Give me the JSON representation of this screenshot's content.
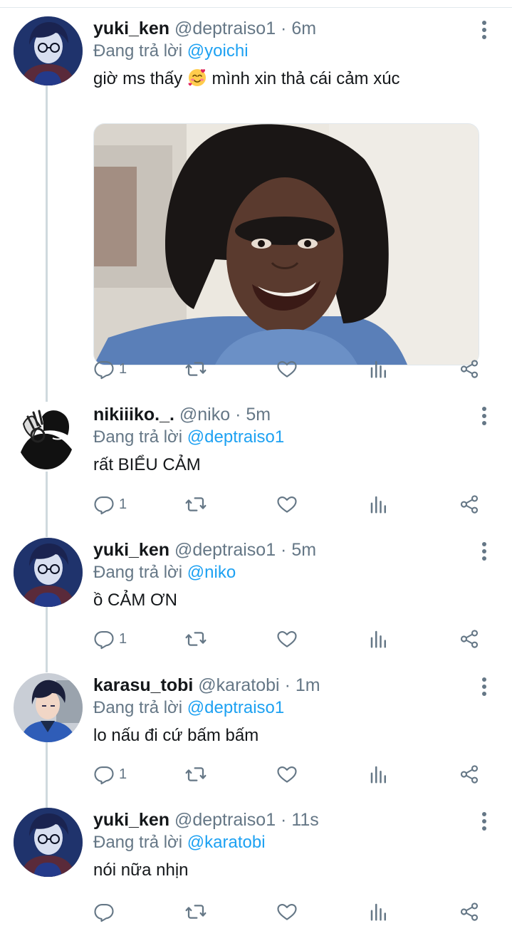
{
  "colors": {
    "accent": "#1da1f2",
    "muted": "#657786",
    "text": "#14171a",
    "thread_line": "#cfd9de"
  },
  "reply_prefix": "Đang trả lời",
  "tweets": [
    {
      "name": "yuki_ken",
      "handle": "@deptraiso1",
      "time": "6m",
      "reply_to": "@yoichi",
      "text_before": "giờ ms thấy",
      "emoji": "smiling-face-with-hearts",
      "text_after": "mình xin thả cái cảm xúc",
      "has_media": true,
      "reply_count": "1",
      "avatar": "blue-hair-glasses-avatar"
    },
    {
      "name": "nikiiiko._.",
      "handle": "@niko",
      "time": "5m",
      "reply_to": "@deptraiso1",
      "text": "rất BIỂU CẢM",
      "reply_count": "1",
      "avatar": "manga-hand-avatar"
    },
    {
      "name": "yuki_ken",
      "handle": "@deptraiso1",
      "time": "5m",
      "reply_to": "@niko",
      "text": "ồ CẢM ƠN",
      "reply_count": "1",
      "avatar": "blue-hair-glasses-avatar"
    },
    {
      "name": "karasu_tobi",
      "handle": "@karatobi",
      "time": "1m",
      "reply_to": "@deptraiso1",
      "text": "lo nấu đi cứ bấm bấm",
      "reply_count": "1",
      "avatar": "dark-hair-blue-jacket-avatar"
    },
    {
      "name": "yuki_ken",
      "handle": "@deptraiso1",
      "time": "11s",
      "reply_to": "@karatobi",
      "text": "nói nữa nhịn",
      "reply_count": "",
      "avatar": "blue-hair-glasses-avatar"
    }
  ]
}
